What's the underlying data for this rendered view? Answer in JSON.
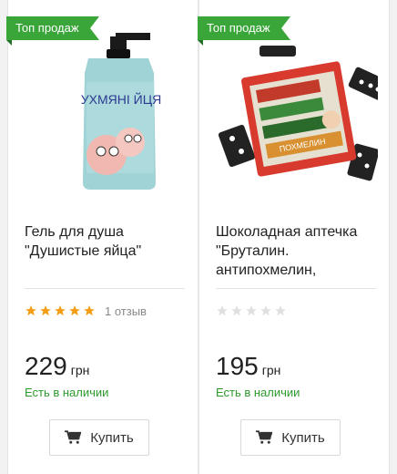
{
  "products": [
    {
      "badge": "Топ продаж",
      "title": "Гель для душа \"Душистые яйца\"",
      "rating": 5,
      "reviews": "1 отзыв",
      "price": "229",
      "currency": "грн",
      "availability": "Есть в наличии",
      "buy_label": "Купить",
      "image_text": "УХМЯНІ ЙЦЯ"
    },
    {
      "badge": "Топ продаж",
      "title": "Шоколадная аптечка \"Бруталин. антипохмелин,",
      "rating": 0,
      "reviews": "",
      "price": "195",
      "currency": "грн",
      "availability": "Есть в наличии",
      "buy_label": "Купить",
      "image_text": "ПОХМЕЛИН"
    }
  ],
  "colors": {
    "accent": "#3aa63a",
    "star_active": "#f39c12",
    "star_inactive": "#e0e0e0",
    "stock": "#2e9a2e"
  }
}
